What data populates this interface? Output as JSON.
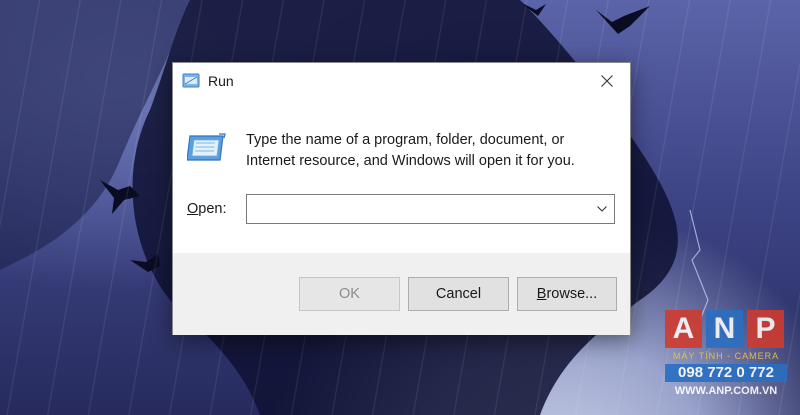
{
  "dialog": {
    "title": "Run",
    "title_icon": "run-icon",
    "close_icon": "close-icon",
    "description": "Type the name of a program, folder, document, or Internet resource, and Windows will open it for you.",
    "open_label_accel": "O",
    "open_label_rest": "pen:",
    "open_value": "",
    "dropdown_icon": "chevron-down-icon"
  },
  "buttons": {
    "ok": "OK",
    "cancel": "Cancel",
    "browse_accel": "B",
    "browse_rest": "rowse..."
  },
  "watermark": {
    "letters": [
      "A",
      "N",
      "P"
    ],
    "tagline": "MÁY TÍNH - CAMERA",
    "phone": "098 772 0 772",
    "url": "WWW.ANP.COM.VN"
  },
  "colors": {
    "brand_red": "#d23a2c",
    "brand_blue": "#2a6fc2",
    "footer_bg": "#f0f0f0"
  }
}
